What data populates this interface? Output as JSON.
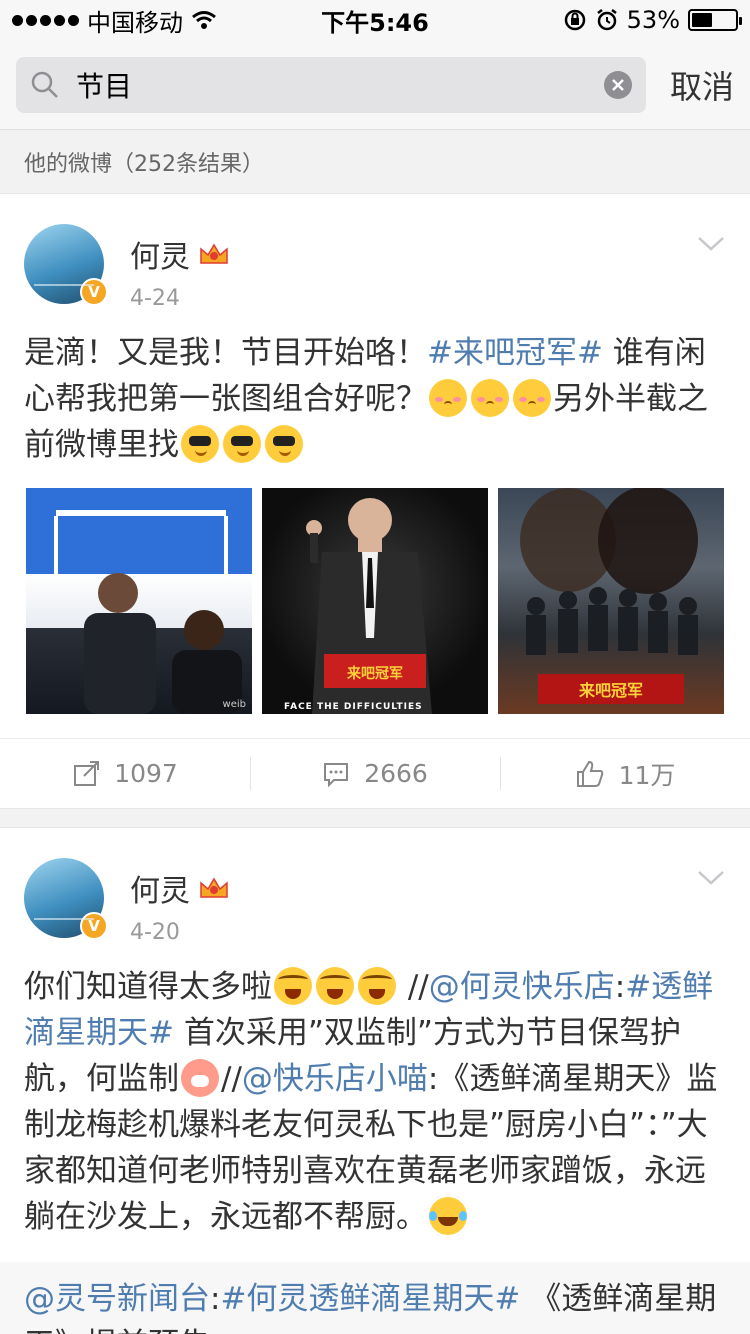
{
  "status_bar": {
    "carrier": "中国移动",
    "time": "下午5:46",
    "battery": "53%",
    "battery_level": 0.53
  },
  "search": {
    "query": "节目",
    "cancel_label": "取消"
  },
  "section_title": "他的微博（252条结果）",
  "posts": [
    {
      "user": "何灵",
      "date": "4-24",
      "text": {
        "a": "是滴！又是我！节目开始咯！",
        "tag": "#来吧冠军#",
        "b": " 谁有闲心帮我把第一张图组合好呢？",
        "c": "另外半截之前微博里找"
      },
      "photos": [
        {
          "caption": "",
          "watermark": "weib"
        },
        {
          "caption": "FACE THE DIFFICULTIES",
          "watermark": ""
        },
        {
          "caption": "",
          "watermark": ""
        }
      ],
      "actions": {
        "repost": "1097",
        "comment": "2666",
        "like": "11万"
      }
    },
    {
      "user": "何灵",
      "date": "4-20",
      "text": {
        "a": "你们知道得太多啦",
        "b": " //",
        "mention1": "@何灵快乐店",
        "c": ":",
        "tag1": "#透鲜滴星期天#",
        "d": " 首次采用”双监制”方式为节目保驾护航，何监制",
        "e": "//",
        "mention2": "@快乐店小喵",
        "f": ":《透鲜滴星期天》监制龙梅趁机爆料老友何灵私下也是”厨房小白”：”大家都知道何老师特别喜欢在黄磊老师家蹭饭，永远躺在沙发上，永远都不帮厨。"
      },
      "repost": {
        "mention": "@灵号新闻台",
        "sep": ":",
        "tag": "#何灵透鲜滴星期天#",
        "text": " 《透鲜滴星期天》提前预告"
      }
    }
  ],
  "colors": {
    "link": "#507daf",
    "verified": "#f5a623"
  }
}
